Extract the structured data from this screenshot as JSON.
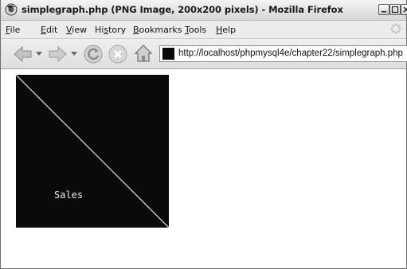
{
  "window": {
    "title": "simplegraph.php (PNG Image, 200x200 pixels) - Mozilla Firefox"
  },
  "menubar": {
    "items": [
      {
        "underline": "F",
        "rest": "ile"
      },
      {
        "underline": "E",
        "rest": "dit"
      },
      {
        "underline": "V",
        "rest": "iew"
      },
      {
        "pre": "Hi",
        "underline": "s",
        "rest": "tory"
      },
      {
        "underline": "B",
        "rest": "ookmarks"
      },
      {
        "underline": "T",
        "rest": "ools"
      },
      {
        "underline": "H",
        "rest": "elp"
      }
    ]
  },
  "navbar": {
    "url": "http://localhost/phpmysql4e/chapter22/simplegraph.php"
  },
  "content": {
    "image_label": "Sales"
  },
  "icons": {
    "back": "back-arrow-icon",
    "forward": "forward-arrow-icon",
    "reload": "reload-icon",
    "stop": "stop-icon",
    "home": "home-icon"
  },
  "colors": {
    "image_background": "#0a0a0a",
    "image_line": "#bfbfbf",
    "image_text": "#e8e8e8"
  }
}
